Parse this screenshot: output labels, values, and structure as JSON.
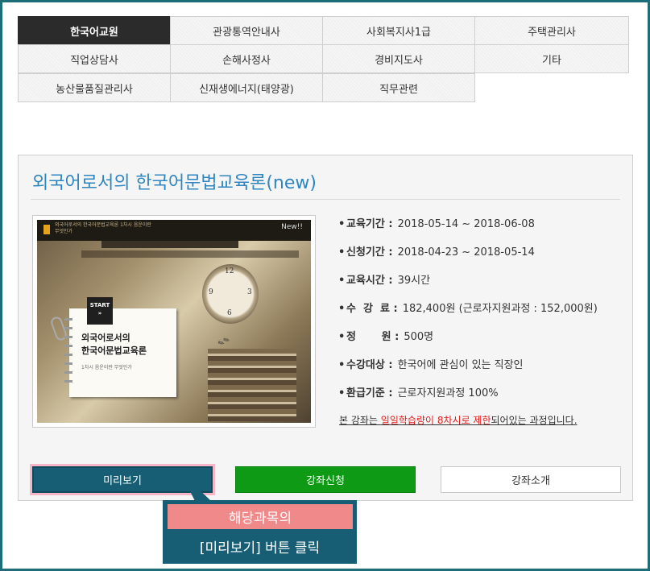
{
  "categories": {
    "rows": [
      [
        "한국어교원",
        "관광통역안내사",
        "사회복지사1급",
        "주택관리사"
      ],
      [
        "직업상담사",
        "손해사정사",
        "경비지도사",
        "기타"
      ],
      [
        "농산물품질관리사",
        "신재생에너지(태양광)",
        "직무관련"
      ]
    ],
    "active": "한국어교원"
  },
  "course": {
    "title": "외국어로서의 한국어문법교육론(new)",
    "thumbnail": {
      "badge": "New!!",
      "start": "START",
      "start_arrow": "»",
      "line1": "외국어로서의",
      "line2": "한국어문법교육론",
      "line3": "1차시 음운이란 무엇인가",
      "brand": "외국어로서의 한국어문법교육론 1차시 음운이란 무엇인가"
    },
    "info": [
      {
        "label": "교육기간 :",
        "value": "2018-05-14 ~ 2018-06-08"
      },
      {
        "label": "신청기간 :",
        "value": "2018-04-23 ~ 2018-05-14"
      },
      {
        "label": "교육시간 :",
        "value": "39시간"
      },
      {
        "label": "수  강  료 :",
        "value": "182,400원 (근로자지원과정 : 152,000원)"
      },
      {
        "label": "정       원 :",
        "value": "500명"
      },
      {
        "label": "수강대상 :",
        "value": "한국어에 관심이 있는 직장인"
      },
      {
        "label": "환급기준 :",
        "value": "근로자지원과정 100%"
      }
    ],
    "notice": {
      "before": "본 강좌는 ",
      "highlight": "일일학습량이 8차시로 제한",
      "after": "되어있는 과정입니다."
    },
    "buttons": {
      "preview": "미리보기",
      "apply": "강좌신청",
      "intro": "강좌소개"
    }
  },
  "callout": {
    "line1": "해당과목의",
    "line2": "[미리보기] 버튼 클릭"
  },
  "colors": {
    "frame": "#1d6e78",
    "title": "#2e86c1",
    "preview_button": "#175e74",
    "apply_button": "#0e9a14",
    "highlight": "#e02020",
    "callout_top": "#f08a8a"
  }
}
